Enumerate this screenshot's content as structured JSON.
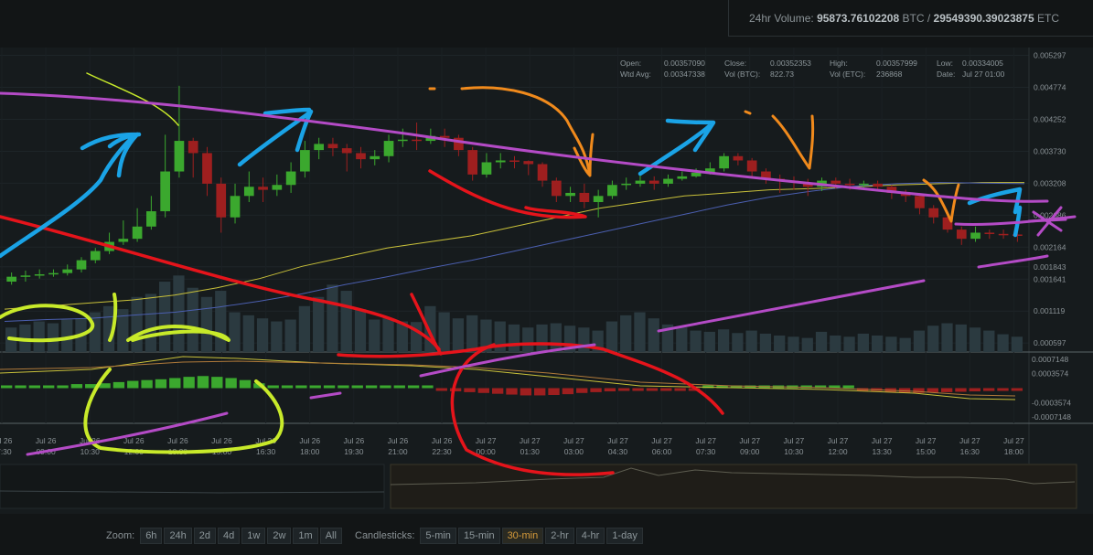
{
  "header": {
    "volume_label": "24hr Volume:",
    "volume_btc": "95873.76102208",
    "unit_btc": "BTC",
    "separator": "/",
    "volume_etc": "29549390.39023875",
    "unit_etc": "ETC"
  },
  "ohlc": {
    "open_label": "Open:",
    "open": "0.00357090",
    "close_label": "Close:",
    "close": "0.00352353",
    "high_label": "High:",
    "high": "0.00357999",
    "low_label": "Low:",
    "low": "0.00334005",
    "wtd_label": "Wtd Avg:",
    "wtd": "0.00347338",
    "volbtc_label": "Vol (BTC):",
    "volbtc": "822.73",
    "voletc_label": "Vol (ETC):",
    "voletc": "236868",
    "date_label": "Date:",
    "date": "Jul 27 01:00"
  },
  "colors": {
    "up": "#3ba82e",
    "down": "#9e1f1f",
    "volume": "#2b3a40",
    "ma_fast": "#c9c13a",
    "ma_slow": "#4b5fb0",
    "annot_yellow": "#c8ea2a",
    "annot_red": "#e5141b",
    "annot_blue": "#1aa3e6",
    "annot_orange": "#f08a1c",
    "annot_purple": "#b44bc6"
  },
  "chart_data": {
    "type": "candlestick",
    "price_ticks": [
      "0.005297",
      "0.004774",
      "0.004252",
      "0.003730",
      "0.003208",
      "0.002686",
      "0.002164",
      "0.001843",
      "0.001641",
      "0.001119",
      "0.000597"
    ],
    "macd_ticks": [
      "0.0007148",
      "0.0003574",
      "-0.0003574",
      "-0.0007148"
    ],
    "x_ticks": [
      [
        "Jul 26",
        "07:30"
      ],
      [
        "Jul 26",
        "09:00"
      ],
      [
        "Jul 26",
        "10:30"
      ],
      [
        "Jul 26",
        "12:00"
      ],
      [
        "Jul 26",
        "13:30"
      ],
      [
        "Jul 26",
        "15:00"
      ],
      [
        "Jul 26",
        "16:30"
      ],
      [
        "Jul 26",
        "18:00"
      ],
      [
        "Jul 26",
        "19:30"
      ],
      [
        "Jul 26",
        "21:00"
      ],
      [
        "Jul 26",
        "22:30"
      ],
      [
        "Jul 27",
        "00:00"
      ],
      [
        "Jul 27",
        "01:30"
      ],
      [
        "Jul 27",
        "03:00"
      ],
      [
        "Jul 27",
        "04:30"
      ],
      [
        "Jul 27",
        "06:00"
      ],
      [
        "Jul 27",
        "07:30"
      ],
      [
        "Jul 27",
        "09:00"
      ],
      [
        "Jul 27",
        "10:30"
      ],
      [
        "Jul 27",
        "12:00"
      ],
      [
        "Jul 27",
        "13:30"
      ],
      [
        "Jul 27",
        "15:00"
      ],
      [
        "Jul 27",
        "16:30"
      ],
      [
        "Jul 27",
        "18:00"
      ]
    ],
    "candles": [
      [
        0.0016,
        0.00168,
        0.00175,
        0.00155
      ],
      [
        0.00168,
        0.0017,
        0.00178,
        0.0016
      ],
      [
        0.0017,
        0.00172,
        0.0018,
        0.00165
      ],
      [
        0.00172,
        0.00174,
        0.0018,
        0.00168
      ],
      [
        0.00174,
        0.0018,
        0.00188,
        0.0017
      ],
      [
        0.0018,
        0.00195,
        0.002,
        0.00175
      ],
      [
        0.00195,
        0.0021,
        0.00215,
        0.0019
      ],
      [
        0.0021,
        0.00225,
        0.0024,
        0.00205
      ],
      [
        0.00225,
        0.0023,
        0.0026,
        0.0022
      ],
      [
        0.0023,
        0.0025,
        0.0028,
        0.00225
      ],
      [
        0.0025,
        0.00275,
        0.003,
        0.00245
      ],
      [
        0.00275,
        0.0034,
        0.004,
        0.00265
      ],
      [
        0.0034,
        0.0039,
        0.0048,
        0.0033
      ],
      [
        0.0039,
        0.0037,
        0.00395,
        0.0033
      ],
      [
        0.0037,
        0.0032,
        0.0038,
        0.003
      ],
      [
        0.0032,
        0.00265,
        0.0033,
        0.0024
      ],
      [
        0.00265,
        0.003,
        0.0032,
        0.00255
      ],
      [
        0.003,
        0.00315,
        0.0034,
        0.0029
      ],
      [
        0.00315,
        0.0031,
        0.0033,
        0.0029
      ],
      [
        0.0031,
        0.00318,
        0.00335,
        0.003
      ],
      [
        0.00318,
        0.0034,
        0.00355,
        0.00305
      ],
      [
        0.0034,
        0.00375,
        0.0039,
        0.0033
      ],
      [
        0.00375,
        0.00385,
        0.00395,
        0.0036
      ],
      [
        0.00385,
        0.00378,
        0.00395,
        0.00365
      ],
      [
        0.00378,
        0.0037,
        0.00385,
        0.0034
      ],
      [
        0.0037,
        0.0036,
        0.0038,
        0.00345
      ],
      [
        0.0036,
        0.00365,
        0.00375,
        0.0035
      ],
      [
        0.00365,
        0.0039,
        0.004,
        0.00355
      ],
      [
        0.0039,
        0.00392,
        0.0041,
        0.0038
      ],
      [
        0.00392,
        0.0039,
        0.0042,
        0.00375
      ],
      [
        0.0039,
        0.00398,
        0.0041,
        0.00385
      ],
      [
        0.00398,
        0.00395,
        0.0041,
        0.0038
      ],
      [
        0.00395,
        0.00375,
        0.004,
        0.00365
      ],
      [
        0.00375,
        0.00335,
        0.0038,
        0.00325
      ],
      [
        0.00335,
        0.00355,
        0.0037,
        0.0033
      ],
      [
        0.00355,
        0.00358,
        0.0037,
        0.00345
      ],
      [
        0.00358,
        0.00356,
        0.00365,
        0.00345
      ],
      [
        0.00357,
        0.00352,
        0.00358,
        0.00334
      ],
      [
        0.00352,
        0.00325,
        0.00355,
        0.00315
      ],
      [
        0.00325,
        0.003,
        0.0033,
        0.0029
      ],
      [
        0.003,
        0.00305,
        0.00315,
        0.0029
      ],
      [
        0.00305,
        0.0029,
        0.0032,
        0.0028
      ],
      [
        0.0029,
        0.003,
        0.0031,
        0.00265
      ],
      [
        0.003,
        0.00318,
        0.00325,
        0.00295
      ],
      [
        0.00318,
        0.0032,
        0.0033,
        0.0031
      ],
      [
        0.0032,
        0.00325,
        0.00335,
        0.00315
      ],
      [
        0.00325,
        0.0032,
        0.00332,
        0.0031
      ],
      [
        0.0032,
        0.00328,
        0.00335,
        0.00315
      ],
      [
        0.00328,
        0.00332,
        0.0034,
        0.00325
      ],
      [
        0.00332,
        0.00338,
        0.00345,
        0.0033
      ],
      [
        0.00338,
        0.00345,
        0.00355,
        0.00335
      ],
      [
        0.00345,
        0.00365,
        0.0037,
        0.0034
      ],
      [
        0.00365,
        0.00358,
        0.0037,
        0.0035
      ],
      [
        0.00358,
        0.0034,
        0.00362,
        0.0033
      ],
      [
        0.0034,
        0.00328,
        0.00345,
        0.0032
      ],
      [
        0.00328,
        0.00325,
        0.00335,
        0.00305
      ],
      [
        0.00325,
        0.00322,
        0.00332,
        0.0031
      ],
      [
        0.00322,
        0.00315,
        0.00328,
        0.003
      ],
      [
        0.00315,
        0.00325,
        0.0033,
        0.00308
      ],
      [
        0.00325,
        0.0032,
        0.0033,
        0.00312
      ],
      [
        0.0032,
        0.00318,
        0.00328,
        0.0031
      ],
      [
        0.00318,
        0.0032,
        0.00325,
        0.00312
      ],
      [
        0.0032,
        0.00315,
        0.00325,
        0.00308
      ],
      [
        0.00315,
        0.00305,
        0.00318,
        0.00295
      ],
      [
        0.00305,
        0.003,
        0.0031,
        0.0029
      ],
      [
        0.003,
        0.0028,
        0.00305,
        0.0027
      ],
      [
        0.0028,
        0.00265,
        0.00285,
        0.00255
      ],
      [
        0.00265,
        0.00245,
        0.0027,
        0.0024
      ],
      [
        0.00245,
        0.0023,
        0.0025,
        0.0022
      ],
      [
        0.0023,
        0.0024,
        0.0025,
        0.00225
      ],
      [
        0.0024,
        0.00238,
        0.00245,
        0.0023
      ],
      [
        0.00238,
        0.00237,
        0.00245,
        0.0023
      ],
      [
        0.00237,
        0.00235,
        0.00242,
        0.00225
      ]
    ],
    "volumes": [
      0.00085,
      0.0009,
      0.00095,
      0.00092,
      0.00098,
      0.001,
      0.0011,
      0.0012,
      0.00115,
      0.00135,
      0.0014,
      0.0016,
      0.0017,
      0.0015,
      0.00135,
      0.00145,
      0.0011,
      0.00105,
      0.001,
      0.00095,
      0.00098,
      0.0012,
      0.00135,
      0.00155,
      0.00145,
      0.00115,
      0.00098,
      0.001,
      0.00095,
      0.00094,
      0.0012,
      0.0011,
      0.001,
      0.00105,
      0.00098,
      0.00095,
      0.0009,
      0.00085,
      0.0009,
      0.00092,
      0.00088,
      0.00085,
      0.0008,
      0.00095,
      0.00105,
      0.0011,
      0.001,
      0.0009,
      0.00085,
      0.0008,
      0.00078,
      0.00082,
      0.00076,
      0.0008,
      0.00075,
      0.00072,
      0.0007,
      0.00068,
      0.00078,
      0.00072,
      0.0007,
      0.00075,
      0.00072,
      0.0007,
      0.00068,
      0.0008,
      0.00088,
      0.00092,
      0.0009,
      0.00085,
      0.0008,
      0.00074,
      0.0007
    ],
    "ma_fast": [
      0.00115,
      0.0012,
      0.00125,
      0.0013,
      0.00138,
      0.0015,
      0.00165,
      0.00185,
      0.002,
      0.00215,
      0.00225,
      0.00235,
      0.0025,
      0.00265,
      0.0028,
      0.0029,
      0.003,
      0.00305,
      0.0031,
      0.00312,
      0.00315,
      0.00318,
      0.0032,
      0.00322,
      0.00322
    ],
    "ma_slow": [
      0.00095,
      0.00098,
      0.001,
      0.00105,
      0.0011,
      0.00118,
      0.00128,
      0.0014,
      0.00155,
      0.00168,
      0.00182,
      0.00195,
      0.0021,
      0.00225,
      0.0024,
      0.00255,
      0.0027,
      0.00285,
      0.00298,
      0.00308,
      0.00316,
      0.0032,
      0.00322,
      0.00321,
      0.0032
    ],
    "macd_hist": [
      0,
      0,
      0,
      0,
      0,
      0.0001,
      0.0001,
      0.00012,
      0.00015,
      0.00018,
      0.0002,
      0.00022,
      0.00025,
      0.00028,
      0.0003,
      0.00028,
      0.00025,
      0.0002,
      0.00012,
      5e-05,
      2e-05,
      1e-05,
      0,
      0,
      0,
      0,
      0,
      0,
      0,
      0,
      0,
      -5e-05,
      -8e-05,
      -0.0001,
      -0.00012,
      -0.00014,
      -0.00016,
      -0.00018,
      -0.00018,
      -0.00017,
      -0.00015,
      -0.00012,
      -0.0001,
      -8e-05,
      -6e-05,
      -5e-05,
      -4e-05,
      -3e-05,
      -2e-05,
      -1e-05,
      0,
      0,
      0,
      0,
      0,
      0,
      0,
      0,
      0,
      0,
      0,
      -5e-05,
      -7e-05,
      -0.0001,
      -0.00012,
      -0.00012,
      -0.00011,
      -0.0001,
      -9e-05,
      -8e-05,
      -7e-05,
      -6e-05,
      -5e-05
    ]
  },
  "controls": {
    "zoom_label": "Zoom:",
    "zoom": [
      "6h",
      "24h",
      "2d",
      "4d",
      "1w",
      "2w",
      "1m",
      "All"
    ],
    "candle_label": "Candlesticks:",
    "candles": [
      "5-min",
      "15-min",
      "30-min",
      "2-hr",
      "4-hr",
      "1-day"
    ],
    "candle_selected": "30-min"
  }
}
